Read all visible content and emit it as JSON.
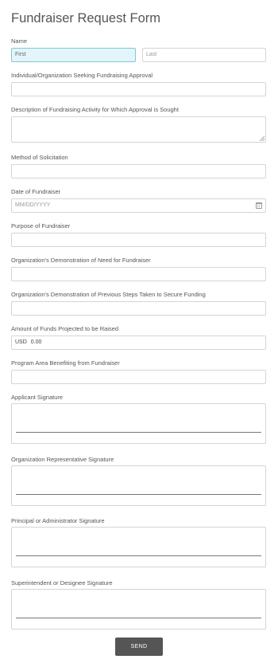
{
  "form": {
    "title": "Fundraiser Request Form",
    "name": {
      "label": "Name",
      "first_placeholder": "First",
      "last_placeholder": "Last"
    },
    "individual_org": {
      "label": "Individual/Organization Seeking Fundraising Approval"
    },
    "description": {
      "label": "Description of Fundraising Activity for Which Approval is Sought"
    },
    "method": {
      "label": "Method of Solicitation"
    },
    "date": {
      "label": "Date of Fundraiser",
      "placeholder": "MM/DD/YYYY",
      "icon": "calendar-icon"
    },
    "purpose": {
      "label": "Purpose of Fundraiser"
    },
    "need": {
      "label": "Organization's Demonstration of Need for Fundraiser"
    },
    "previous_steps": {
      "label": "Organization's Demonstration of Previous Steps Taken to Secure Funding"
    },
    "amount": {
      "label": "Amount of Funds Projected to be Raised",
      "currency": "USD",
      "value": "0.00"
    },
    "program_area": {
      "label": "Program Area Benefiting from Fundraiser"
    },
    "signatures": [
      {
        "label": "Applicant Signature"
      },
      {
        "label": "Organization Representative Signature"
      },
      {
        "label": "Principal or Administrator Signature"
      },
      {
        "label": "Superintendent or Designee Signature"
      }
    ],
    "submit_label": "SEND"
  }
}
